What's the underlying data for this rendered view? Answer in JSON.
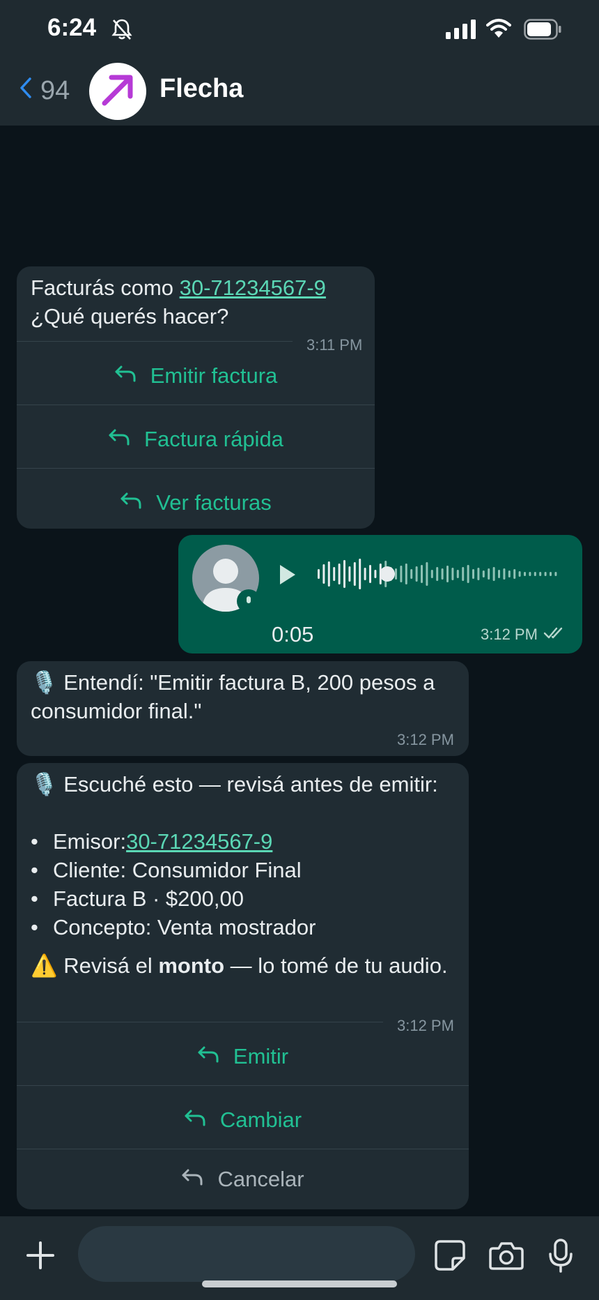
{
  "status_bar": {
    "time": "6:24",
    "icons": [
      "bell-off-icon",
      "signal-icon",
      "wifi-icon",
      "battery-icon"
    ]
  },
  "header": {
    "back_count": "94",
    "title": "Flecha",
    "avatar_icon": "arrow-up-right-icon"
  },
  "messages": [
    {
      "direction": "in",
      "text_prefix": "Facturás como ",
      "link": "30-71234567-9",
      "text_line2": "¿Qué querés hacer?",
      "time": "3:11 PM",
      "buttons": [
        "Emitir factura",
        "Factura rápida",
        "Ver facturas"
      ]
    },
    {
      "direction": "out",
      "type": "voice",
      "duration": "0:05",
      "time": "3:12 PM",
      "read": true
    },
    {
      "direction": "in",
      "text": "🎙️ Entendí: \"Emitir factura B, 200 pesos a consumidor final.\"",
      "time": "3:12 PM"
    },
    {
      "direction": "in",
      "intro": "🎙️ Escuché esto — revisá antes de emitir:",
      "bullets": [
        {
          "label": "Emisor: ",
          "link": "30-71234567-9"
        },
        {
          "label": "Cliente: Consumidor Final"
        },
        {
          "label": "Factura B · $200,00"
        },
        {
          "label": "Concepto: Venta mostrador"
        }
      ],
      "warning_prefix": "⚠️ Revisá el ",
      "warning_bold": "monto",
      "warning_suffix": " — lo tomé de tu audio.",
      "time": "3:12 PM",
      "buttons": [
        "Emitir",
        "Cambiar",
        "Cancelar"
      ]
    }
  ],
  "composer": {
    "icons": [
      "plus-icon",
      "sticker-icon",
      "camera-icon",
      "mic-icon"
    ]
  },
  "colors": {
    "accent": "#21c093",
    "bubble_in": "#202c33",
    "bubble_out": "#005c4b",
    "background": "#0b141a"
  }
}
